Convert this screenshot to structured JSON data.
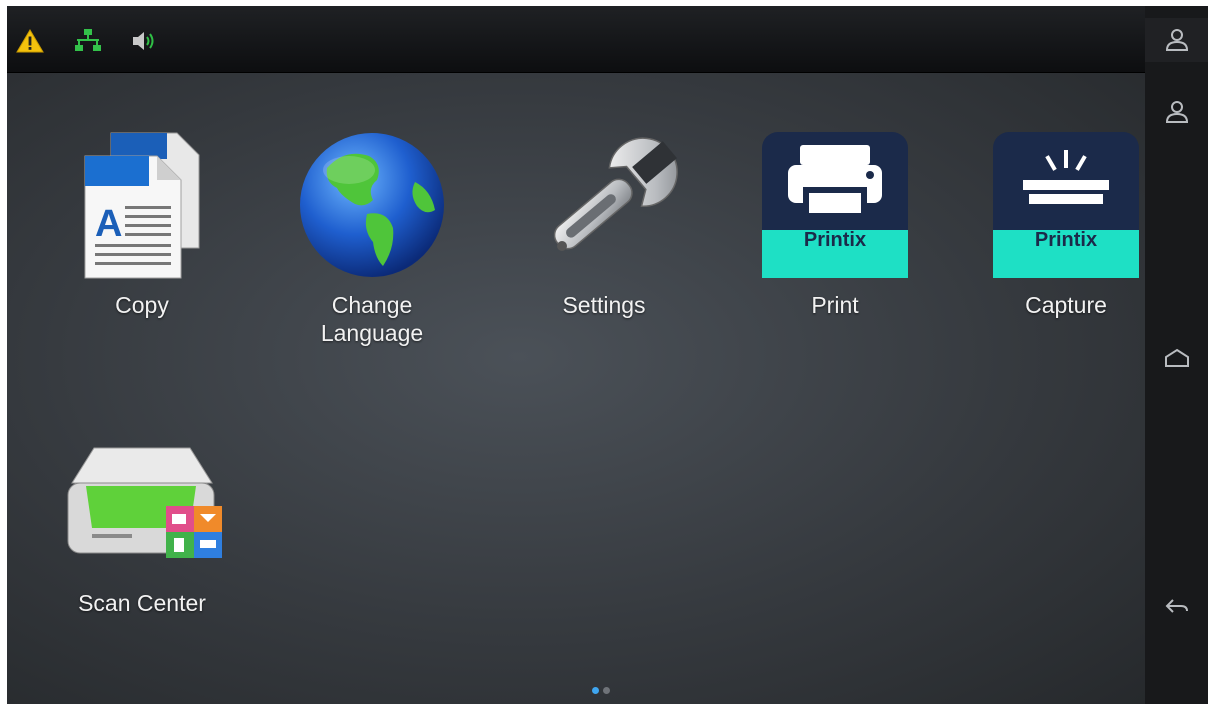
{
  "status_bar": {
    "icons": [
      {
        "name": "warning-icon",
        "color": "#f4c20d"
      },
      {
        "name": "network-icon",
        "color": "#33c14a"
      },
      {
        "name": "speaker-icon",
        "color": "#2fbf45"
      }
    ]
  },
  "apps": [
    {
      "label": "Copy",
      "icon": "copy-document-icon"
    },
    {
      "label": "Change\nLanguage",
      "icon": "globe-icon"
    },
    {
      "label": "Settings",
      "icon": "wrench-icon"
    },
    {
      "label": "Print",
      "icon": "printix-print-icon",
      "badge": "Printix"
    },
    {
      "label": "Capture",
      "icon": "printix-capture-icon",
      "badge": "Printix"
    },
    {
      "label": "Scan Center",
      "icon": "scanner-icon"
    }
  ],
  "right_rail": {
    "buttons": [
      {
        "name": "user-icon"
      },
      {
        "name": "user-icon"
      },
      {
        "name": "home-icon"
      },
      {
        "name": "back-icon"
      }
    ]
  },
  "pagination": {
    "pages": 2,
    "current": 1
  },
  "colors": {
    "accent": "#3fa6f0",
    "printix_dark": "#1b2a4a",
    "printix_band": "#1ee0c5"
  }
}
